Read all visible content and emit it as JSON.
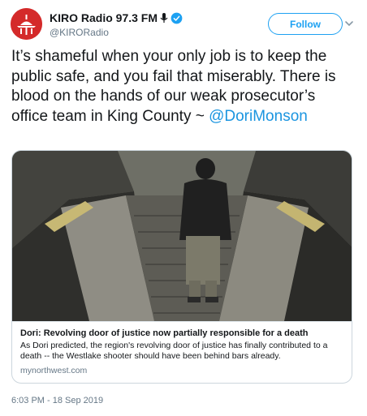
{
  "account": {
    "display_name": "KIRO Radio 97.3 FM",
    "handle": "@KIRORadio",
    "avatar_icon": "kiro-logo-icon",
    "verified_icon": "verified-badge-icon",
    "mic_icon": "microphone-icon",
    "brand_color": "#d42a2a"
  },
  "actions": {
    "follow_label": "Follow",
    "menu_icon": "chevron-down-icon"
  },
  "tweet": {
    "text": "It’s shameful when your only job is to keep the public safe, and you fail that miserably. There is blood on the hands of our weak prosecutor’s office team in King County ~ ",
    "mention": "@DoriMonson",
    "link_color": "#1b95e0"
  },
  "card": {
    "title": "Dori: Revolving door of justice now partially responsible for a death",
    "description": "As Dori predicted, the region's revolving door of justice has finally contributed to a death -- the Westlake shooter should have been behind bars already.",
    "domain": "mynorthwest.com"
  },
  "timestamp": "6:03 PM - 18 Sep 2019"
}
